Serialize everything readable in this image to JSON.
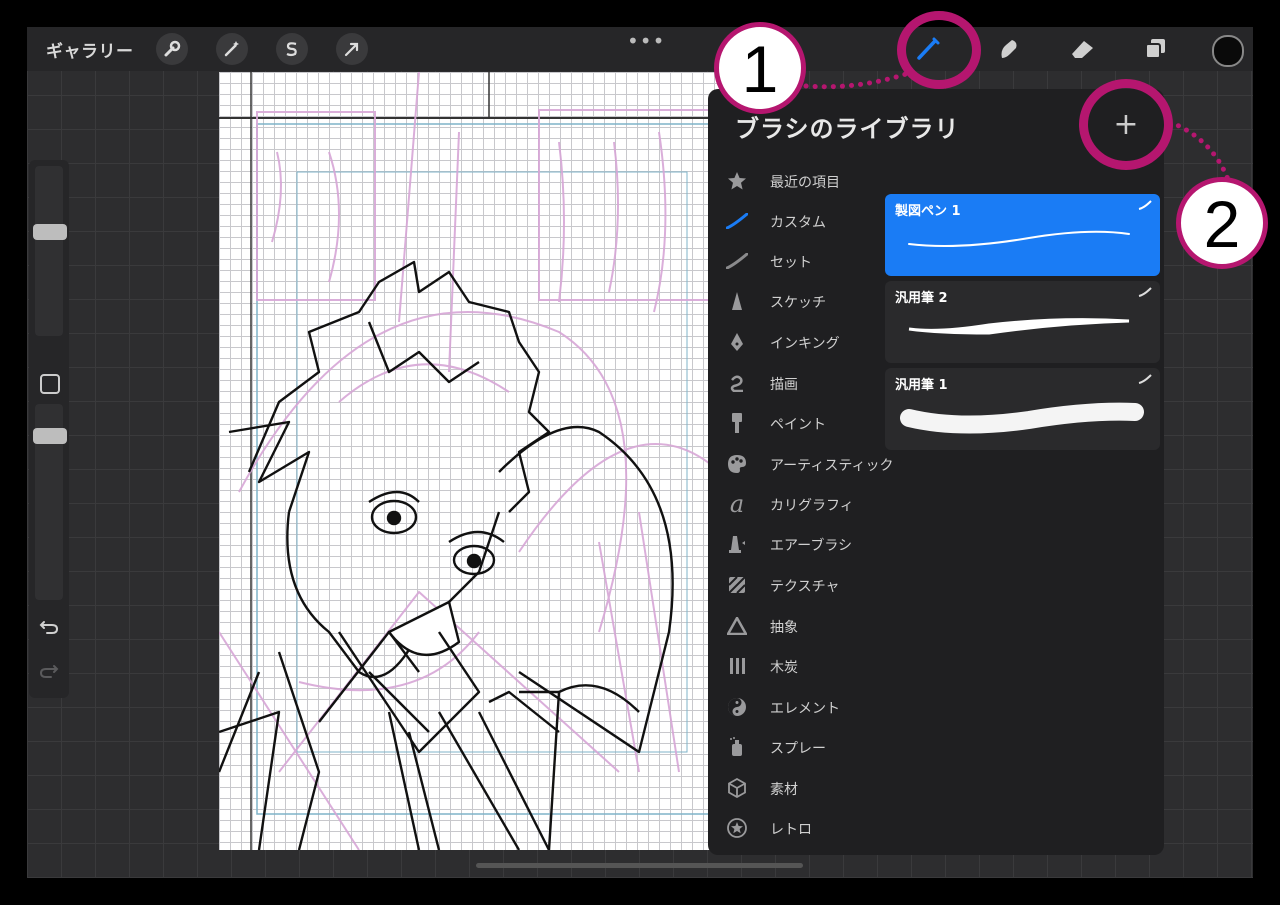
{
  "toolbar": {
    "gallery_label": "ギャラリー",
    "left_tools": [
      "wrench-icon",
      "magic-wand-icon",
      "selection-s-icon",
      "move-arrow-icon"
    ],
    "right_tools": [
      "brush-icon",
      "smudge-icon",
      "eraser-icon",
      "layers-icon"
    ],
    "active_tool": "brush-icon",
    "current_color": "#0a0a0a",
    "more_label": "•••"
  },
  "brush_library": {
    "title": "ブラシのライブラリ",
    "add_label": "+",
    "categories": [
      {
        "label": "最近の項目",
        "icon": "star-icon"
      },
      {
        "label": "カスタム",
        "icon": "custom-stroke-icon"
      },
      {
        "label": "セット",
        "icon": "set-stroke-icon"
      },
      {
        "label": "スケッチ",
        "icon": "sketch-pencil-icon"
      },
      {
        "label": "インキング",
        "icon": "pen-nib-icon"
      },
      {
        "label": "描画",
        "icon": "drawing-curve-icon"
      },
      {
        "label": "ペイント",
        "icon": "paint-brush-icon"
      },
      {
        "label": "アーティスティック",
        "icon": "palette-icon"
      },
      {
        "label": "カリグラフィ",
        "icon": "calligraphy-icon"
      },
      {
        "label": "エアーブラシ",
        "icon": "airbrush-icon"
      },
      {
        "label": "テクスチャ",
        "icon": "texture-icon"
      },
      {
        "label": "抽象",
        "icon": "abstract-triangle-icon"
      },
      {
        "label": "木炭",
        "icon": "charcoal-icon"
      },
      {
        "label": "エレメント",
        "icon": "yin-yang-icon"
      },
      {
        "label": "スプレー",
        "icon": "spray-can-icon"
      },
      {
        "label": "素材",
        "icon": "cube-icon"
      },
      {
        "label": "レトロ",
        "icon": "retro-star-icon"
      }
    ],
    "active_category": "カスタム",
    "brushes": [
      {
        "name": "製図ペン 1",
        "selected": true
      },
      {
        "name": "汎用筆 2",
        "selected": false
      },
      {
        "name": "汎用筆 1",
        "selected": false
      }
    ]
  },
  "annotations": [
    {
      "number": "1"
    },
    {
      "number": "2"
    }
  ],
  "colors": {
    "accent_blue": "#1a7cf5",
    "annotation_magenta": "#b5166f",
    "panel_bg": "#1f1f21",
    "toolbar_bg": "#262628"
  }
}
